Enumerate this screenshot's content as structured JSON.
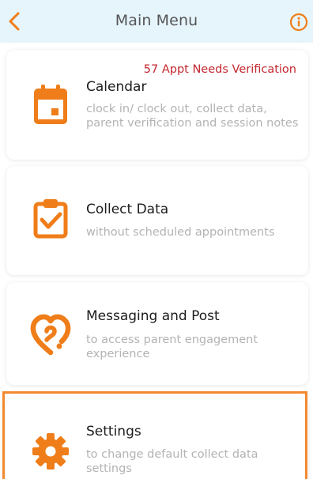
{
  "header": {
    "title": "Main Menu",
    "back_icon": "chevron-left-icon",
    "info_icon": "info-circle-icon"
  },
  "menu": {
    "calendar": {
      "title": "Calendar",
      "description": "clock in/ clock out, collect data, parent verification and session notes",
      "badge": "57 Appt Needs Verification",
      "icon": "calendar-icon"
    },
    "collect_data": {
      "title": "Collect Data",
      "description": "without scheduled appointments",
      "icon": "clipboard-check-icon"
    },
    "messaging": {
      "title": "Messaging and Post",
      "description": "to access parent engagement experience",
      "icon": "heart-chat-icon"
    },
    "settings": {
      "title": "Settings",
      "description": "to change default collect data settings",
      "icon": "gear-icon"
    }
  },
  "colors": {
    "accent": "#ef7d19",
    "header_bg": "#e6f5fc",
    "badge": "#c3272f",
    "highlight_border": "#f2892f"
  }
}
